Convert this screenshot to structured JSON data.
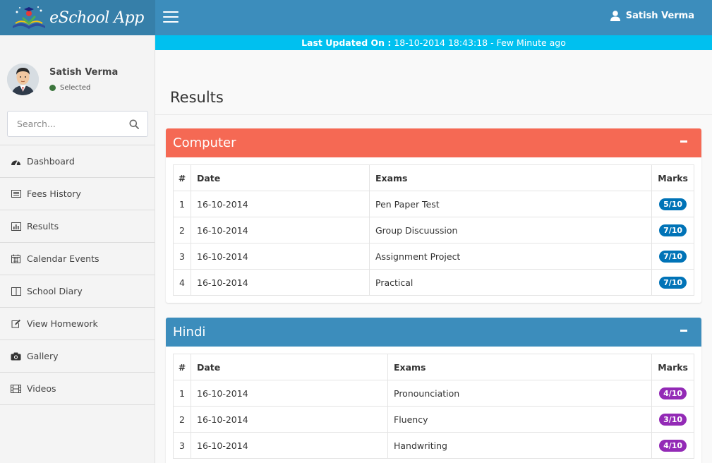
{
  "header": {
    "app_name": "eSchool App",
    "user_name": "Satish Verma",
    "colors": {
      "logo_bg": "#367fa9",
      "topbar_bg": "#3c8dbc"
    }
  },
  "update_bar": {
    "label": "Last Updated On :",
    "value": "18-10-2014 18:43:18 - Few Minute ago"
  },
  "sidebar": {
    "user_name": "Satish Verma",
    "status": "Selected",
    "search_placeholder": "Search...",
    "items": [
      {
        "label": "Dashboard",
        "icon": "dashboard-icon"
      },
      {
        "label": "Fees History",
        "icon": "list-icon"
      },
      {
        "label": "Results",
        "icon": "bar-chart-icon"
      },
      {
        "label": "Calendar Events",
        "icon": "calendar-icon"
      },
      {
        "label": "School Diary",
        "icon": "book-icon"
      },
      {
        "label": "View Homework",
        "icon": "edit-icon"
      },
      {
        "label": "Gallery",
        "icon": "camera-icon"
      },
      {
        "label": "Videos",
        "icon": "film-icon"
      }
    ]
  },
  "main": {
    "page_title": "Results",
    "columns": [
      "#",
      "Date",
      "Exams",
      "Marks"
    ],
    "subjects": [
      {
        "name": "Computer",
        "header_color": "#f56954",
        "badge_color": "#0073b7",
        "rows": [
          {
            "num": "1",
            "date": "16-10-2014",
            "exam": "Pen Paper Test",
            "marks": "5/10"
          },
          {
            "num": "2",
            "date": "16-10-2014",
            "exam": "Group Discuussion",
            "marks": "7/10"
          },
          {
            "num": "3",
            "date": "16-10-2014",
            "exam": "Assignment Project",
            "marks": "7/10"
          },
          {
            "num": "4",
            "date": "16-10-2014",
            "exam": "Practical",
            "marks": "7/10"
          }
        ]
      },
      {
        "name": "Hindi",
        "header_color": "#3c8dbc",
        "badge_color": "#932ab6",
        "rows": [
          {
            "num": "1",
            "date": "16-10-2014",
            "exam": "Pronounciation",
            "marks": "4/10"
          },
          {
            "num": "2",
            "date": "16-10-2014",
            "exam": "Fluency",
            "marks": "3/10"
          },
          {
            "num": "3",
            "date": "16-10-2014",
            "exam": "Handwriting",
            "marks": "4/10"
          }
        ]
      }
    ]
  }
}
